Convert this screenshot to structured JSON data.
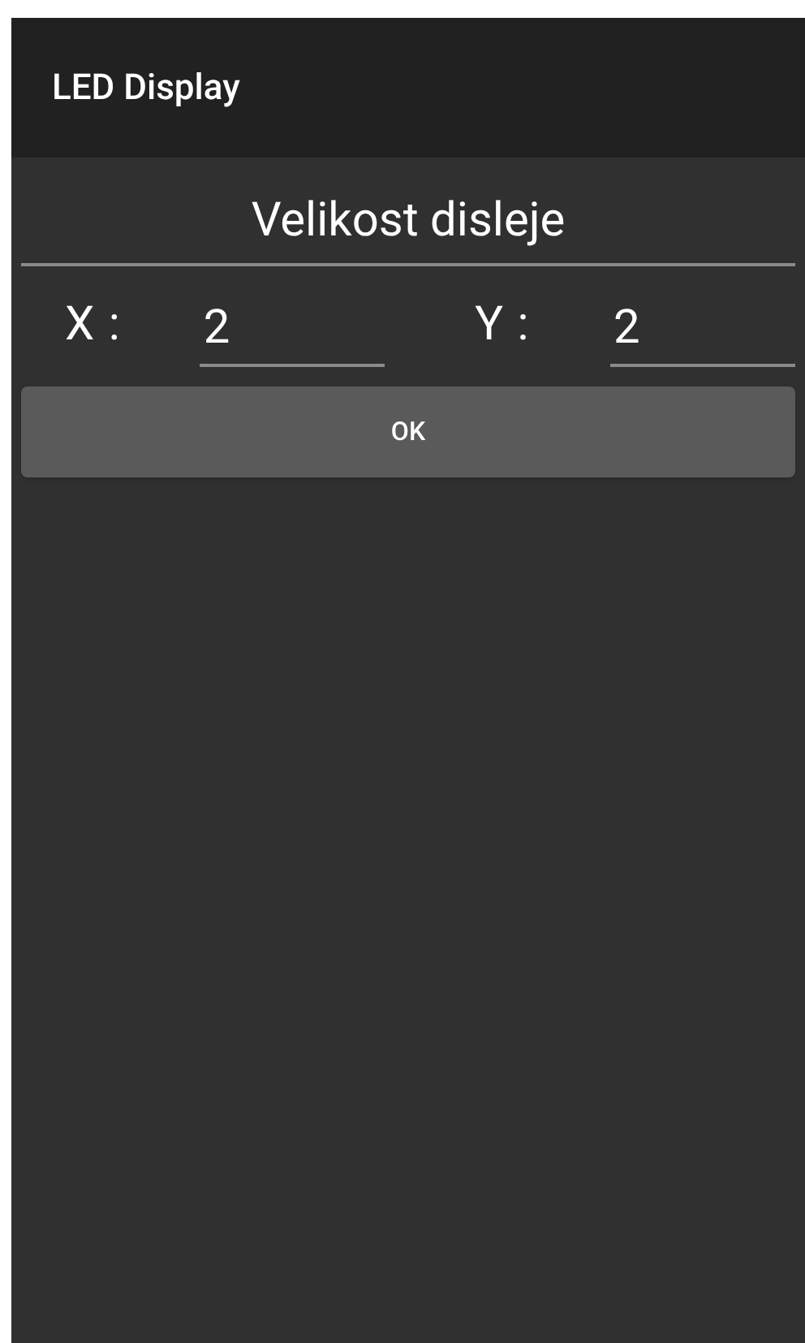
{
  "app_bar": {
    "title": "LED Display"
  },
  "heading": "Velikost disleje",
  "fields": [
    {
      "label": "X :",
      "value": "2"
    },
    {
      "label": "Y :",
      "value": "2"
    }
  ],
  "button": "OK"
}
